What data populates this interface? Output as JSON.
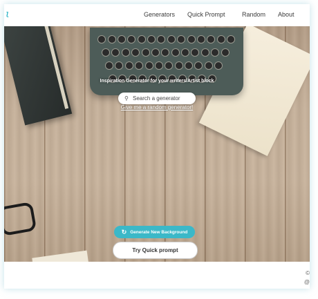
{
  "brand": {
    "logo_text": "ι",
    "accent": "#2fb5c9"
  },
  "nav": {
    "items": [
      {
        "label": "Generators"
      },
      {
        "label": "Quick Prompt"
      },
      {
        "label": "Random"
      },
      {
        "label": "About"
      }
    ]
  },
  "hero": {
    "tagline": "Inspiration Generator for your writers/Artist block",
    "search": {
      "placeholder": "Search a generator",
      "icon": "search-icon"
    },
    "random_link": "Give me a random generator!",
    "generate_button": {
      "label": "Generate New Background",
      "icon": "refresh-icon",
      "color": "#3bb8c8"
    },
    "quick_button": {
      "label": "Try Quick prompt"
    }
  },
  "footer": {
    "icon_1": "©",
    "icon_2": "@"
  }
}
